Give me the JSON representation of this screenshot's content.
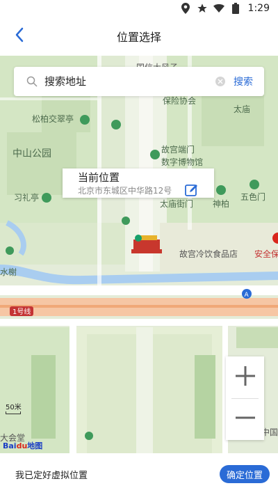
{
  "status_bar": {
    "time": "1:29"
  },
  "header": {
    "title": "位置选择"
  },
  "search": {
    "placeholder": "搜索地址",
    "button_label": "搜索"
  },
  "popup": {
    "title": "当前位置",
    "address": "北京市东城区中华路12号"
  },
  "map_labels": {
    "baoxian": "保险协会",
    "taimiao_top": "太庙",
    "songbai": "松柏交翠亭",
    "zhongshan": "中山公园",
    "gugong_duanmen_1": "故宫端门",
    "gugong_duanmen_2": "数字博物馆",
    "xilting": "习礼亭",
    "taimiao_street": "太庙街门",
    "shenbo": "神柏",
    "wuse": "五色门",
    "gugong_food": "故宫冷饮食品店",
    "anquan": "安全保",
    "shuixie": "水榭",
    "line1": "1号线",
    "dahuitang": "大会堂",
    "zhongguo": "中国",
    "top_cut": "国信大风子"
  },
  "zoom": {
    "in_label": "+",
    "out_label": "−"
  },
  "scale": {
    "label": "50米"
  },
  "logo": {
    "text": "Bai",
    "du": "du",
    "suffix": "地图"
  },
  "bottom": {
    "text": "我已定好虚拟位置",
    "confirm_label": "确定位置"
  },
  "colors": {
    "accent": "#2a6bd6",
    "park_green": "#d4e6c4",
    "road": "#ffffff",
    "water": "#a9cdf0",
    "metro": "#f6c6a4"
  },
  "icons": [
    "location-icon",
    "star-icon",
    "wifi-icon",
    "battery-icon",
    "back-arrow-icon",
    "search-icon",
    "clear-icon",
    "edit-icon",
    "zoom-in-icon",
    "zoom-out-icon"
  ]
}
